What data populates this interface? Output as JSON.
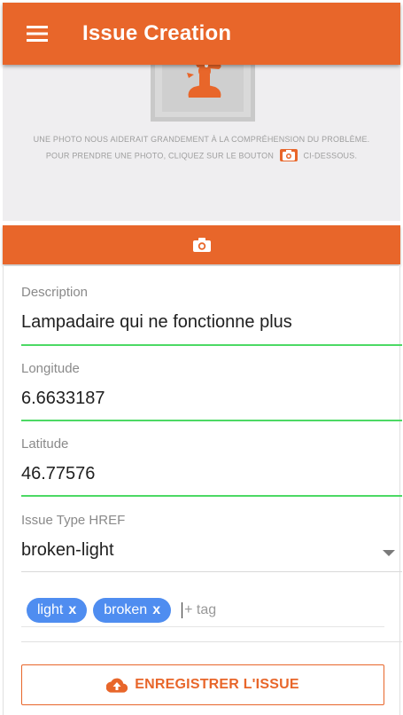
{
  "appbar": {
    "title": "Issue Creation",
    "menu_icon": "hamburger-menu-icon"
  },
  "photo": {
    "placeholder_icon": "illustration-placeholder",
    "hint_line1": "UNE PHOTO NOUS AIDERAIT GRANDEMENT À LA COMPRÉHENSION DU PROBLÈME.",
    "hint_line2_before": "POUR PRENDRE UNE PHOTO, CLIQUEZ SUR LE BOUTON",
    "hint_line2_after": "CI-DESSOUS.",
    "camera_icon": "camera-icon"
  },
  "form": {
    "description": {
      "label": "Description",
      "value": "Lampadaire qui ne fonctionne plus"
    },
    "longitude": {
      "label": "Longitude",
      "value": "6.6633187"
    },
    "latitude": {
      "label": "Latitude",
      "value": "46.77576"
    },
    "issue_type": {
      "label": "Issue Type HREF",
      "value": "broken-light"
    },
    "tags": {
      "items": [
        {
          "label": "light",
          "remove": "x"
        },
        {
          "label": "broken",
          "remove": "x"
        }
      ],
      "placeholder": "+ tag"
    }
  },
  "save_button": {
    "label": "ENREGISTRER L'ISSUE",
    "icon": "cloud-upload-icon"
  },
  "colors": {
    "primary": "#e8662a",
    "valid_underline": "#4cd964",
    "chip": "#4f8df0"
  }
}
